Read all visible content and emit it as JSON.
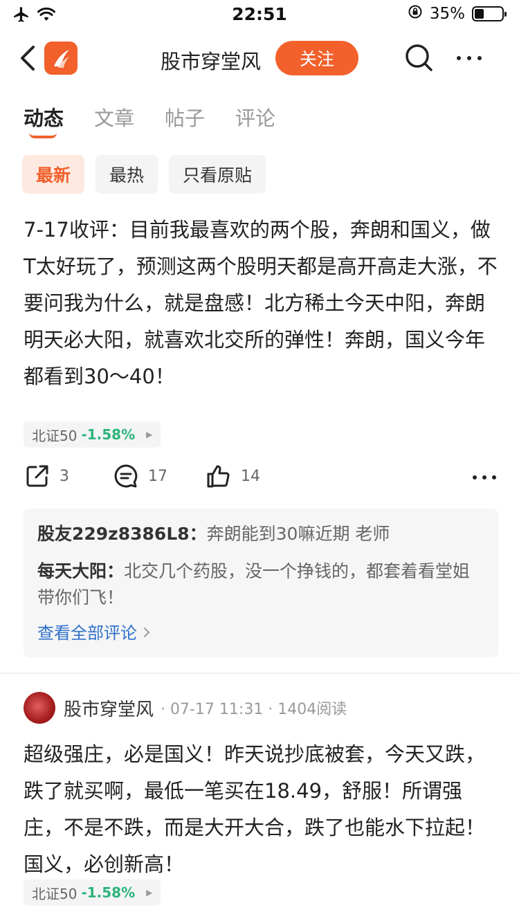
{
  "status_bar": {
    "time": "22:51",
    "battery_percent": "35%",
    "battery_level": 0.35
  },
  "nav": {
    "title": "股市穿堂风",
    "follow_label": "关注"
  },
  "tabs": [
    {
      "label": "动态",
      "active": true
    },
    {
      "label": "文章",
      "active": false
    },
    {
      "label": "帖子",
      "active": false
    },
    {
      "label": "评论",
      "active": false
    }
  ],
  "filters": [
    {
      "label": "最新",
      "active": true
    },
    {
      "label": "最热",
      "active": false
    },
    {
      "label": "只看原贴",
      "active": false
    }
  ],
  "post1": {
    "text": "7-17收评：目前我最喜欢的两个股，奔朗和国义，做T太好玩了，预测这两个股明天都是高开高走大涨，不要问我为什么，就是盘感！北方稀土今天中阳，奔朗明天必大阳，就喜欢北交所的弹性！奔朗，国义今年都看到30～40！",
    "stock": {
      "name": "北证50",
      "change": "-1.58%"
    },
    "share_count": "3",
    "comment_count": "17",
    "like_count": "14",
    "comments": [
      {
        "user": "股友229z8386L8：",
        "text": "奔朗能到30嘛近期 老师"
      },
      {
        "user": "每天大阳：",
        "text": "北交几个药股，没一个挣钱的，都套着看堂姐带你们飞！"
      }
    ],
    "view_all_label": "查看全部评论"
  },
  "post2": {
    "author": "股市穿堂风",
    "meta": "· 07-17 11:31 · 1404阅读",
    "text": "超级强庄，必是国义！昨天说抄底被套，今天又跌，跌了就买啊，最低一笔买在18.49，舒服！所谓强庄，不是不跌，而是大开大合，跌了也能水下拉起！国义，必创新高！",
    "stock": {
      "name": "北证50",
      "change": "-1.58%"
    }
  },
  "colors": {
    "accent": "#f2602b",
    "down_green": "#2db37b",
    "link_blue": "#2e70c9"
  }
}
